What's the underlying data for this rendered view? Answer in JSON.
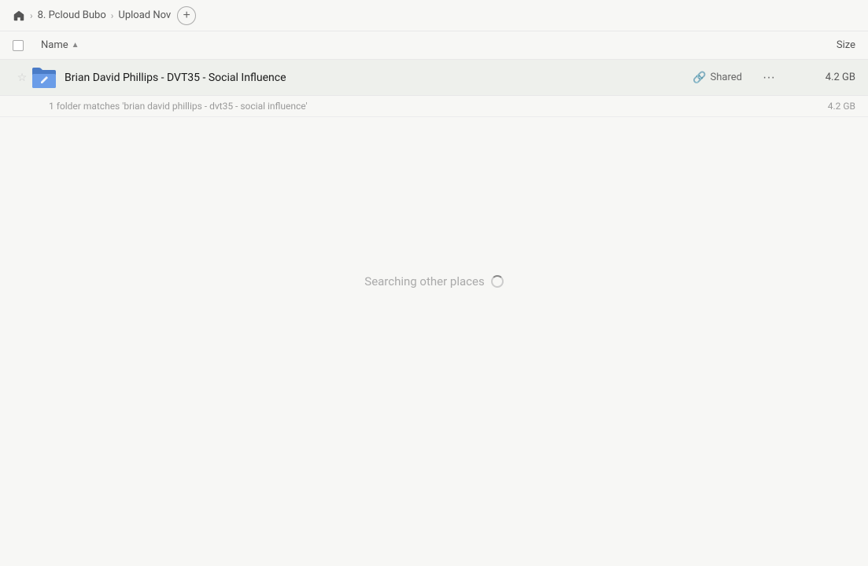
{
  "breadcrumb": {
    "home_label": "Home",
    "items": [
      {
        "label": "8. Pcloud Bubo"
      },
      {
        "label": "Upload Nov"
      }
    ],
    "add_button_label": "+"
  },
  "table_header": {
    "name_col_label": "Name",
    "size_col_label": "Size"
  },
  "file_row": {
    "name": "Brian David Phillips - DVT35 - Social Influence",
    "shared_label": "Shared",
    "size": "4.2 GB",
    "more_icon": "···"
  },
  "match_row": {
    "text": "1 folder matches 'brian david phillips - dvt35 - social influence'",
    "size": "4.2 GB"
  },
  "searching": {
    "label": "Searching other places"
  }
}
